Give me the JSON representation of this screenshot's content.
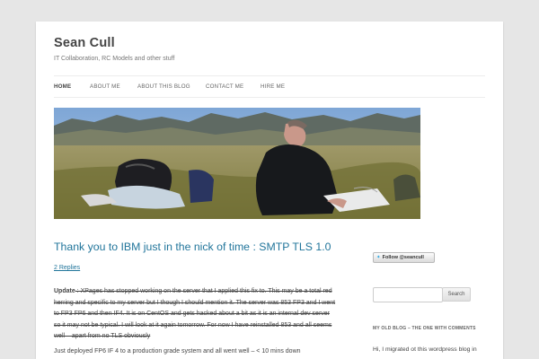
{
  "site": {
    "title": "Sean Cull",
    "description": "IT Collaboration, RC Models and other stuff"
  },
  "nav": {
    "items": [
      {
        "label": "HOME"
      },
      {
        "label": "ABOUT ME"
      },
      {
        "label": "ABOUT THIS BLOG"
      },
      {
        "label": "CONTACT ME"
      },
      {
        "label": "HIRE ME"
      }
    ]
  },
  "post": {
    "title": "Thank you to IBM just in the nick of time : SMTP TLS 1.0",
    "replies": "2 Replies",
    "update_label": "Update",
    "update_text": " : XPages has stopped working on the server that I applied this fix to. This may be a total red herring and specific to my server but I though I should mention it. The server was 853 FP3 and I went to FP3 FP6 and then IF4. It is on CentOS and gets hacked about a bit as it is an internal dev server so it may not be typical. I will look at it again tomorrow. For now I have reinstalled 853 and all seems well – apart from no TLS obviously",
    "body": "Just deployed FP6 IF 4 to a production grade system and all went well – < 10 mins down"
  },
  "sidebar": {
    "follow_label": "Follow @seancull",
    "search_button": "Search",
    "search_value": "",
    "widget_title": "MY OLD BLOG – THE ONE WITH COMMENTS",
    "widget_text": "Hi, I migrated ot this wordpress blog in"
  },
  "colors": {
    "accent_link": "#21759b",
    "page_bg": "#e6e6e6"
  },
  "icons": {
    "follow": "twitter-bird-icon"
  }
}
